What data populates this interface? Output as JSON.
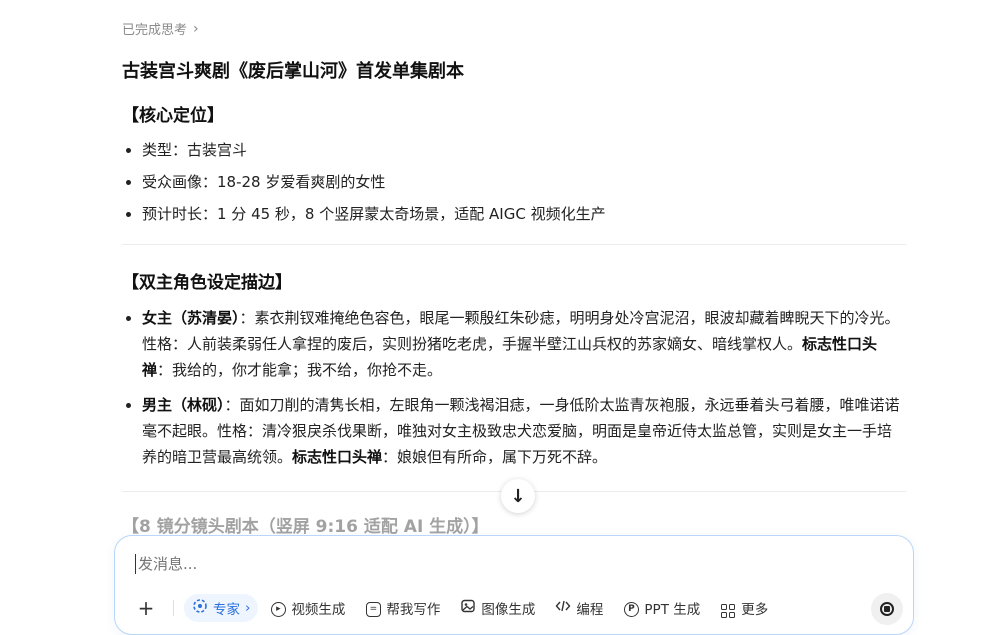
{
  "thinking": {
    "label": "已完成思考",
    "chevron": "›"
  },
  "title": "古装宫斗爽剧《废后掌山河》首发单集剧本",
  "core": {
    "heading": "【核心定位】",
    "items": [
      "类型：古装宫斗",
      "受众画像：18-28 岁爱看爽剧的女性",
      "预计时长：1 分 45 秒，8 个竖屏蒙太奇场景，适配 AIGC 视频化生产"
    ]
  },
  "roles": {
    "heading": "【双主角色设定描边】",
    "female": {
      "name": "女主（苏清晏）",
      "desc": "：素衣荆钗难掩绝色容色，眼尾一颗殷红朱砂痣，明明身处冷宫泥沼，眼波却藏着睥睨天下的冷光。性格：人前装柔弱任人拿捏的废后，实则扮猪吃老虎，手握半壁江山兵权的苏家嫡女、暗线掌权人。",
      "catch_label": "标志性口头禅",
      "catch": "：我给的，你才能拿；我不给，你抢不走。"
    },
    "male": {
      "name": "男主（林砚）",
      "desc": "：面如刀削的清隽长相，左眼角一颗浅褐泪痣，一身低阶太监青灰袍服，永远垂着头弓着腰，唯唯诺诺毫不起眼。性格：清冷狠戾杀伐果断，唯独对女主极致忠犬恋爱脑，明面是皇帝近侍太监总管，实则是女主一手培养的暗卫营最高统领。",
      "catch_label": "标志性口头禅",
      "catch": "：娘娘但有所命，属下万死不辞。"
    }
  },
  "next_heading": "【8 镜分镜头剧本（竖屏 9:16 适配 AI 生成）】",
  "scroll_down_icon": "↓",
  "composer": {
    "placeholder": "发消息...",
    "plus": "+",
    "tools": {
      "expert": "专家",
      "expert_chev": "›",
      "video": "视频生成",
      "writing": "帮我写作",
      "image": "图像生成",
      "code": "编程",
      "ppt": "PPT 生成",
      "more": "更多"
    }
  }
}
